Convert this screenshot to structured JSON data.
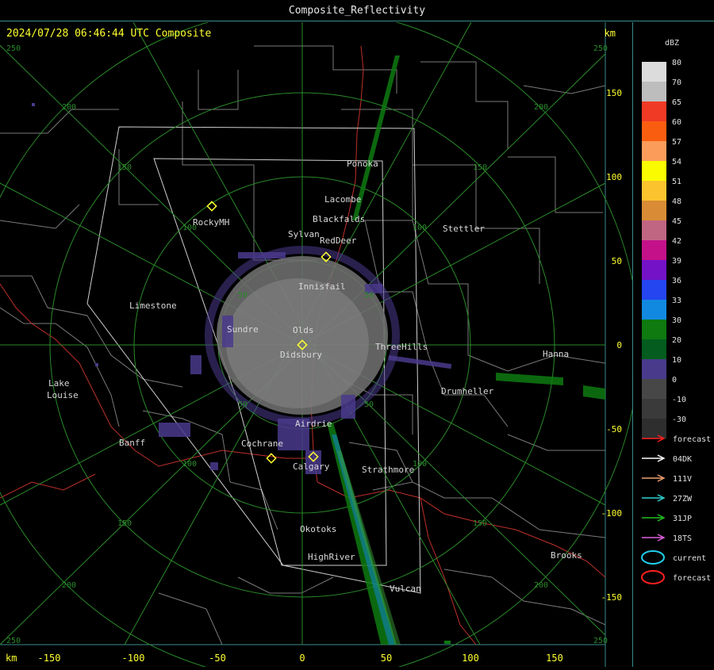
{
  "window": {
    "title": "Composite_Reflectivity"
  },
  "header": {
    "timestamp": "2024/07/28 06:46:44 UTC Composite",
    "unit_label": "km"
  },
  "axes": {
    "x_unit": "km",
    "y_unit": "km",
    "x_ticks": [
      "-150",
      "-100",
      "-50",
      "0",
      "50",
      "100",
      "150"
    ],
    "y_ticks": [
      "150",
      "100",
      "50",
      "0",
      "-50",
      "-100",
      "-150"
    ]
  },
  "range_rings": {
    "corner_labels": [
      "250",
      "250",
      "250",
      "250"
    ],
    "labels": [
      "50",
      "100",
      "150",
      "200"
    ]
  },
  "towns": [
    "Ponoka",
    "Lacombe",
    "Blackfalds",
    "Sylvan",
    "RedDeer",
    "Stettler",
    "RockyMH",
    "Innisfail",
    "Limestone",
    "Sundre",
    "Olds",
    "Didsbury",
    "ThreeHills",
    "Hanna",
    "Lake",
    "Louise",
    "Drumheller",
    "Airdrie",
    "Banff",
    "Cochrane",
    "Calgary",
    "Strathmore",
    "Okotoks",
    "HighRiver",
    "Brooks",
    "Vulcan"
  ],
  "colorbar": {
    "title": "dBZ",
    "bins": [
      {
        "label": "80",
        "color": "#dcdcdc"
      },
      {
        "label": "70",
        "color": "#bdbdbd"
      },
      {
        "label": "65",
        "color": "#f03a25"
      },
      {
        "label": "60",
        "color": "#f95e10"
      },
      {
        "label": "57",
        "color": "#fb9c5a"
      },
      {
        "label": "54",
        "color": "#fbfb00"
      },
      {
        "label": "51",
        "color": "#fbc32d"
      },
      {
        "label": "48",
        "color": "#d98c35"
      },
      {
        "label": "45",
        "color": "#c06582"
      },
      {
        "label": "42",
        "color": "#c4118a"
      },
      {
        "label": "39",
        "color": "#7412c8"
      },
      {
        "label": "36",
        "color": "#2445f0"
      },
      {
        "label": "33",
        "color": "#1289e0"
      },
      {
        "label": "30",
        "color": "#0e7a10"
      },
      {
        "label": "20",
        "color": "#045c1e"
      },
      {
        "label": "10",
        "color": "#4a3a8c"
      },
      {
        "label": "0",
        "color": "#474747"
      },
      {
        "label": "-10",
        "color": "#3a3a3a"
      },
      {
        "label": "-30",
        "color": "#2e2e2e"
      }
    ]
  },
  "legend": {
    "items": [
      {
        "label": "forecast",
        "color": "#ff2020",
        "kind": "arrow"
      },
      {
        "label": "04DK",
        "color": "#ffffff",
        "kind": "arrow"
      },
      {
        "label": "111V",
        "color": "#f0a070",
        "kind": "arrow"
      },
      {
        "label": "27ZW",
        "color": "#30d0d0",
        "kind": "arrow"
      },
      {
        "label": "31JP",
        "color": "#20c020",
        "kind": "arrow"
      },
      {
        "label": "18TS",
        "color": "#e060e0",
        "kind": "arrow"
      },
      {
        "label": "current",
        "color": "#20d0f0",
        "kind": "ellipse"
      },
      {
        "label": "forecast",
        "color": "#ff2020",
        "kind": "ellipse"
      }
    ]
  }
}
